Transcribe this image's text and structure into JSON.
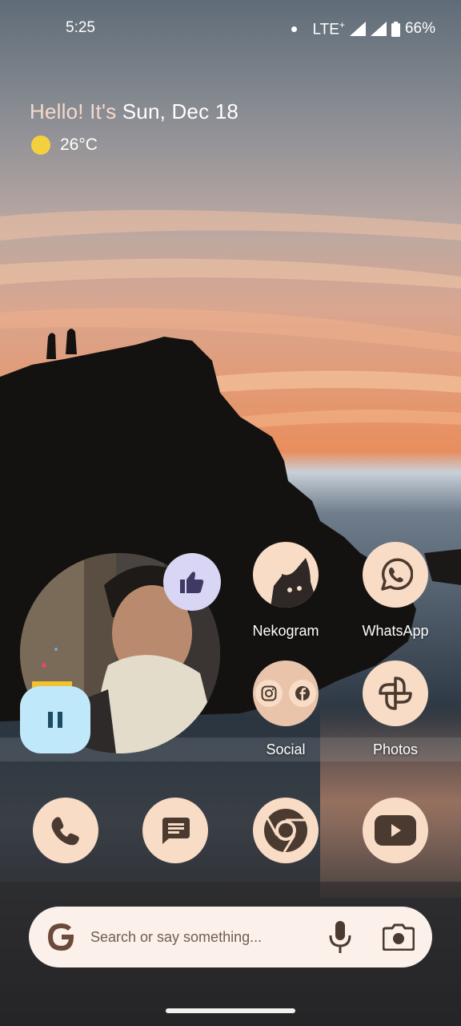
{
  "status_bar": {
    "time": "5:25",
    "network": "LTE",
    "network_plus": "+",
    "battery": "66%"
  },
  "glance": {
    "greeting_prefix": "Hello! It's",
    "date": "Sun, Dec 18",
    "temperature": "26°C",
    "weather_icon": "sun-icon"
  },
  "photo_widget": {
    "like_icon": "thumbs-up-icon",
    "pause_icon": "pause-icon"
  },
  "apps": [
    {
      "label": "Nekogram",
      "icon": "nekogram-cat-icon"
    },
    {
      "label": "WhatsApp",
      "icon": "whatsapp-icon"
    },
    {
      "label": "Social",
      "icon": "folder-icon",
      "contents": [
        "instagram-icon",
        "facebook-icon"
      ]
    },
    {
      "label": "Photos",
      "icon": "photos-pinwheel-icon"
    }
  ],
  "dock": [
    {
      "icon": "phone-icon"
    },
    {
      "icon": "messages-icon"
    },
    {
      "icon": "chrome-icon"
    },
    {
      "icon": "youtube-icon"
    }
  ],
  "search": {
    "placeholder": "Search or say something...",
    "logo": "google-g-icon",
    "mic": "mic-icon",
    "lens": "lens-icon"
  },
  "colors": {
    "icon_bg": "#f8dcc6",
    "icon_fg": "#4a3a30",
    "like_bg": "#d9d6f5",
    "pause_bg": "#bfe8fb",
    "search_bg": "#fbf1ea"
  }
}
